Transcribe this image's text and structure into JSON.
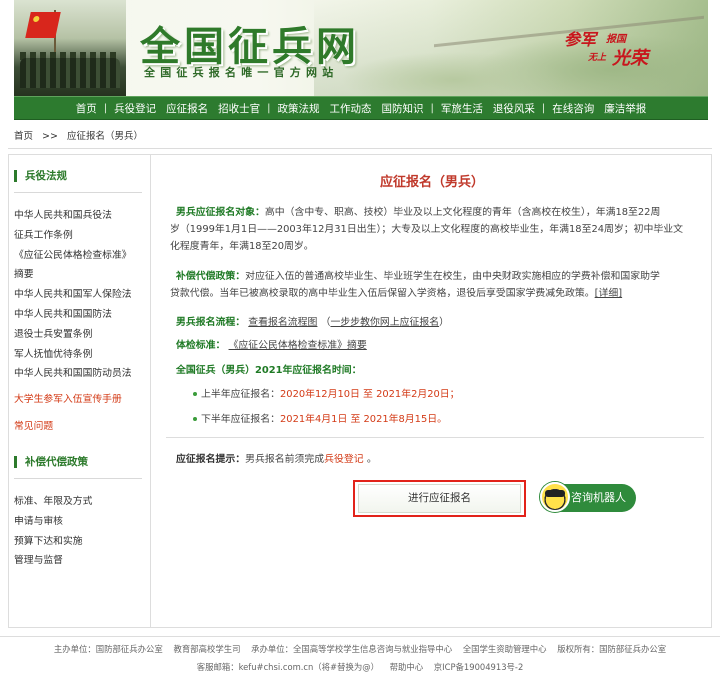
{
  "header": {
    "site_title": "全国征兵网",
    "site_subtitle": "全国征兵报名唯一官方网站",
    "slogan": {
      "part1": "参军",
      "part2": "报国",
      "part3": "无上",
      "part4": "光荣"
    }
  },
  "nav": {
    "items": [
      "首页",
      "兵役登记",
      "应征报名",
      "招收士官",
      "政策法规",
      "工作动态",
      "国防知识",
      "军旅生活",
      "退役风采",
      "在线咨询",
      "廉洁举报"
    ],
    "separators_after": [
      0,
      3,
      6,
      8
    ]
  },
  "breadcrumb": {
    "home": "首页",
    "sep": ">>",
    "current": "应征报名（男兵）"
  },
  "sidebar": {
    "section1_title": "兵役法规",
    "section1_links": [
      "中华人民共和国兵役法",
      "征兵工作条例",
      "《应征公民体格检查标准》",
      "摘要",
      "中华人民共和国军人保险法",
      "中华人民共和国国防法",
      "退役士兵安置条例",
      "军人抚恤优待条例",
      "中华人民共和国国防动员法"
    ],
    "promo_link": "大学生参军入伍宣传手册",
    "faq_link": "常见问题",
    "section2_title": "补偿代偿政策",
    "section2_links": [
      "标准、年限及方式",
      "申请与审核",
      "预算下达和实施",
      "管理与监督"
    ]
  },
  "main": {
    "title": "应征报名（男兵）",
    "target": {
      "label": "男兵应征报名对象：",
      "line1_text": "高中（含中专、职高、技校）毕业及以上文化程度的青年（含高校在校生），年满18至22周",
      "line2": "岁（1999年1月1日——2003年12月31日出生）；大专及以上文化程度的高校毕业生，年满18至24周岁；初中毕业文",
      "line3": "化程度青年，年满18至20周岁。"
    },
    "compensation": {
      "label": "补偿代偿政策：",
      "line1_text": "对应征入伍的普通高校毕业生、毕业班学生在校生，由中央财政实施相应的学费补偿和国家助学",
      "line2": "贷款代偿。当年已被高校录取的高中毕业生入伍后保留入学资格，退役后享受国家学费减免政策。",
      "detail_link": "[详细]"
    },
    "process": {
      "label": "男兵报名流程：",
      "link1": "查看报名流程图",
      "link2_pre": "（",
      "link2": "一步步教你网上应征报名",
      "link2_post": "）"
    },
    "physical": {
      "label": "体检标准：",
      "link": "《应征公民体格检查标准》",
      "suffix": "摘要"
    },
    "period": {
      "title": "全国征兵（男兵）2021年应征报名时间：",
      "first_label": "上半年应征报名：",
      "first_start": "2020年12月10日",
      "first_to": "至",
      "first_end": "2021年2月20日；",
      "second_label": "下半年应征报名：",
      "second_start": "2021年4月1日",
      "second_to": "至",
      "second_end": "2021年8月15日。"
    },
    "tip": {
      "label": "应征报名提示：",
      "text": "男兵报名前须完成",
      "link": "兵役登记",
      "end": "。"
    },
    "register_button": "进行应征报名",
    "robot_button": "咨询机器人"
  },
  "footer": {
    "sponsor": "主办单位：国防部征兵办公室",
    "sponsor2": "教育部高校学生司",
    "organizer": "承办单位：全国高等学校学生信息咨询与就业指导中心",
    "organizer2": "全国学生资助管理中心",
    "copyright": "版权所有：国防部征兵办公室",
    "email": "客服邮箱：kefu#chsi.com.cn（将#替换为@）",
    "help": "帮助中心",
    "icp": "京ICP备19004913号-2"
  }
}
